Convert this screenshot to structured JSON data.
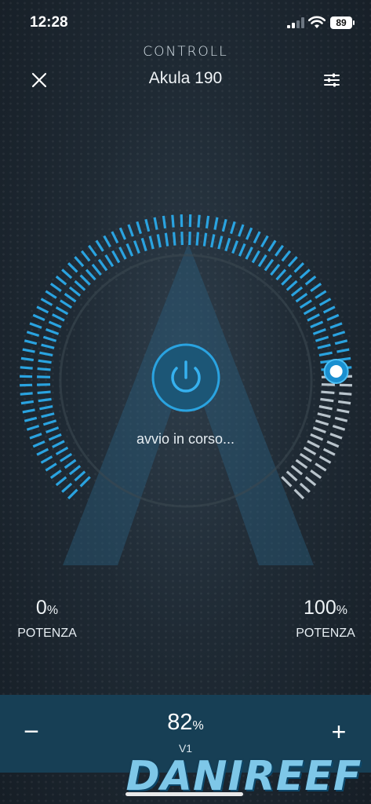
{
  "status_bar": {
    "time": "12:28",
    "battery": "89"
  },
  "header": {
    "logo": "CONTROLL",
    "title": "Akula 190",
    "close_icon": "close-icon",
    "settings_icon": "sliders-icon"
  },
  "dial": {
    "status_text": "avvio in corso...",
    "level_fraction": 0.82,
    "power_icon": "power-icon"
  },
  "range": {
    "min_value": "0",
    "min_unit": "%",
    "min_label": "POTENZA",
    "max_value": "100",
    "max_unit": "%",
    "max_label": "POTENZA"
  },
  "speed_control": {
    "minus_label": "−",
    "plus_label": "+",
    "value": "82",
    "unit": "%",
    "mode_label": "V1"
  },
  "watermark": {
    "brand": "DANIREEF"
  },
  "colors": {
    "accent": "#2aa3e0",
    "inactive_tick": "#b9c4cc",
    "bottom_bar": "#173f55"
  }
}
